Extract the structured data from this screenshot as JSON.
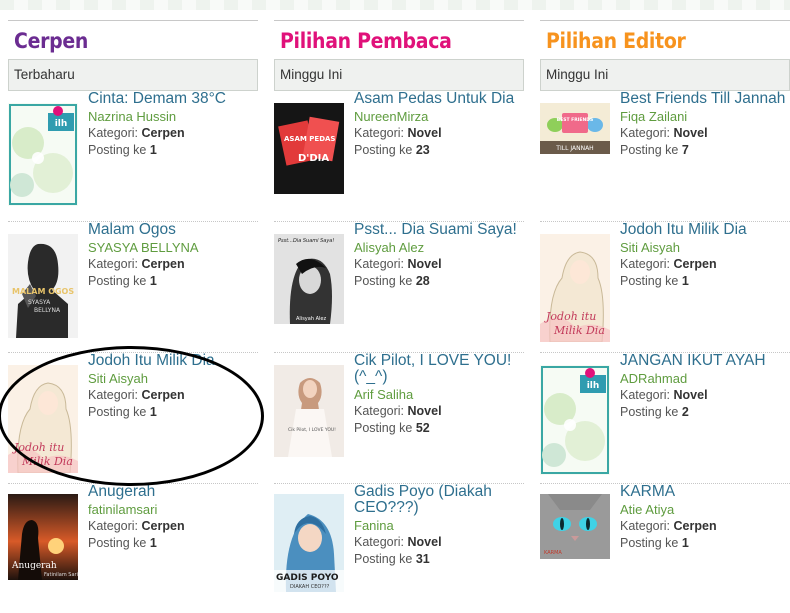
{
  "columns": [
    {
      "title": "Cerpen",
      "title_color": "#6b2c91",
      "filter": "Terbaharu",
      "items": [
        {
          "title": "Cinta: Demam 38°C",
          "author": "Nazrina Hussin",
          "kategori_label": "Kategori:",
          "kategori": "Cerpen",
          "posting_label": "Posting ke",
          "posting": "1",
          "cover": "ilham-logo-cover"
        },
        {
          "title": "Malam Ogos",
          "author": "SYASYA BELLYNA",
          "kategori_label": "Kategori:",
          "kategori": "Cerpen",
          "posting_label": "Posting ke",
          "posting": "1",
          "cover": "silhouette-cover",
          "cover_text": "MALAM OGOS",
          "cover_text2": "SYASYA",
          "cover_text3": "BELLYNA"
        },
        {
          "title": "Jodoh Itu Milik Dia",
          "author": "Siti Aisyah",
          "kategori_label": "Kategori:",
          "kategori": "Cerpen",
          "posting_label": "Posting ke",
          "posting": "1",
          "cover": "hijab-girl-cover",
          "cover_text": "Jodoh itu",
          "cover_text2": "Milik Dia"
        },
        {
          "title": "Anugerah",
          "author": "fatinilamsari",
          "kategori_label": "Kategori:",
          "kategori": "Cerpen",
          "posting_label": "Posting ke",
          "posting": "1",
          "cover": "sunset-cover",
          "cover_text": "Anugerah",
          "cover_text2": "Fatinilam Sari"
        }
      ]
    },
    {
      "title": "Pilihan Pembaca",
      "title_color": "#e0117a",
      "filter": "Minggu Ini",
      "items": [
        {
          "title": "Asam Pedas Untuk Dia",
          "author": "NureenMirza",
          "kategori_label": "Kategori:",
          "kategori": "Novel",
          "posting_label": "Posting ke",
          "posting": "23",
          "cover": "red-bags-cover",
          "cover_text": "ASAM PEDAS",
          "cover_text2": "D'DIA"
        },
        {
          "title": "Psst... Dia Suami Saya!",
          "author": "Alisyah Alez",
          "kategori_label": "Kategori:",
          "kategori": "Novel",
          "posting_label": "Posting ke",
          "posting": "28",
          "cover": "bw-portrait-cover",
          "cover_text": "Psst...Dia Suami Saya!",
          "cover_text2": "Alisyah Alez"
        },
        {
          "title": "Cik Pilot, I LOVE YOU! (^_^)",
          "author": "Arif Saliha",
          "kategori_label": "Kategori:",
          "kategori": "Novel",
          "posting_label": "Posting ke",
          "posting": "52",
          "cover": "bride-cover",
          "cover_text": "Cik Pilot, I LOVE YOU!"
        },
        {
          "title": "Gadis Poyo (Diakah CEO???)",
          "author": "Fanina",
          "kategori_label": "Kategori:",
          "kategori": "Novel",
          "posting_label": "Posting ke",
          "posting": "31",
          "cover": "hijab-blue-cover",
          "cover_text": "GADIS POYO",
          "cover_text2": "DIAKAH CEO???"
        }
      ]
    },
    {
      "title": "Pilihan Editor",
      "title_color": "#f7931e",
      "filter": "Minggu Ini",
      "items": [
        {
          "title": "Best Friends Till Jannah",
          "author": "Fiqa Zailani",
          "kategori_label": "Kategori:",
          "kategori": "Novel",
          "posting_label": "Posting ke",
          "posting": "7",
          "cover": "birds-cover",
          "cover_text": "BEST FRIENDS",
          "cover_text2": "TILL JANNAH"
        },
        {
          "title": "Jodoh Itu Milik Dia",
          "author": "Siti Aisyah",
          "kategori_label": "Kategori:",
          "kategori": "Cerpen",
          "posting_label": "Posting ke",
          "posting": "1",
          "cover": "hijab-girl-cover",
          "cover_text": "Jodoh itu",
          "cover_text2": "Milik Dia"
        },
        {
          "title": "JANGAN IKUT AYAH",
          "author": "ADRahmad",
          "kategori_label": "Kategori:",
          "kategori": "Novel",
          "posting_label": "Posting ke",
          "posting": "2",
          "cover": "ilham-logo-cover"
        },
        {
          "title": "KARMA",
          "author": "Atie Atiya",
          "kategori_label": "Kategori:",
          "kategori": "Cerpen",
          "posting_label": "Posting ke",
          "posting": "1",
          "cover": "cat-eyes-cover",
          "cover_text": "KARMA"
        }
      ]
    }
  ],
  "colors": {
    "title_link": "#2e6f8e",
    "author_link": "#5f9c3f",
    "annotation": "#000000"
  }
}
